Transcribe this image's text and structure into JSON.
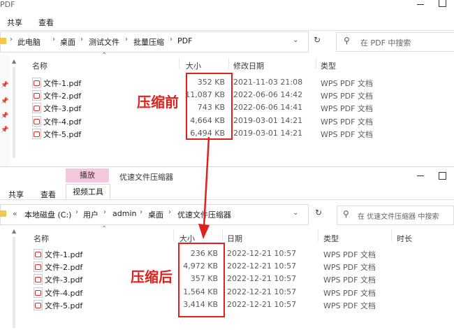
{
  "top_window": {
    "title": "PDF",
    "ribbon": {
      "tabs": [
        "共享",
        "查看"
      ]
    },
    "address": [
      "此电脑",
      "桌面",
      "测试文件",
      "批量压缩",
      "PDF"
    ],
    "search_placeholder": "在 PDF 中搜索",
    "columns": {
      "name": "名称",
      "size": "大小",
      "date": "修改日期",
      "type": "类型"
    },
    "rows": [
      {
        "name": "文件-1.pdf",
        "size": "352 KB",
        "date": "2021-11-03 21:08",
        "type": "WPS PDF 文档"
      },
      {
        "name": "文件-2.pdf",
        "size": "11,087 KB",
        "date": "2022-06-06 14:42",
        "type": "WPS PDF 文档"
      },
      {
        "name": "文件-3.pdf",
        "size": "743 KB",
        "date": "2022-06-06 14:41",
        "type": "WPS PDF 文档"
      },
      {
        "name": "文件-4.pdf",
        "size": "4,664 KB",
        "date": "2019-03-01 14:21",
        "type": "WPS PDF 文档"
      },
      {
        "name": "文件-5.pdf",
        "size": "6,494 KB",
        "date": "2019-03-01 14:21",
        "type": "WPS PDF 文档"
      }
    ],
    "annotation": "压缩前"
  },
  "bottom_window": {
    "title": "优速文件压缩器",
    "context_tab": "播放",
    "ribbon": {
      "tabs": [
        "共享",
        "查看"
      ],
      "context_tool": "视频工具"
    },
    "address_prefix": "«",
    "address": [
      "本地磁盘 (C:)",
      "用户",
      "admin",
      "桌面",
      "优速文件压缩器"
    ],
    "search_placeholder": "在 优速文件压缩器 中搜索",
    "columns": {
      "name": "名称",
      "size": "大小",
      "date": "日期",
      "type": "类型",
      "duration": "时长"
    },
    "rows": [
      {
        "name": "文件-1.pdf",
        "size": "236 KB",
        "date": "2022-12-21 10:57",
        "type": "WPS PDF 文档"
      },
      {
        "name": "文件-2.pdf",
        "size": "4,972 KB",
        "date": "2022-12-21 10:57",
        "type": "WPS PDF 文档"
      },
      {
        "name": "文件-3.pdf",
        "size": "357 KB",
        "date": "2022-12-21 10:57",
        "type": "WPS PDF 文档"
      },
      {
        "name": "文件-4.pdf",
        "size": "1,564 KB",
        "date": "2022-12-21 10:57",
        "type": "WPS PDF 文档"
      },
      {
        "name": "文件-5.pdf",
        "size": "3,414 KB",
        "date": "2022-12-21 10:57",
        "type": "WPS PDF 文档"
      }
    ],
    "annotation": "压缩后"
  },
  "icons": {
    "window_controls": [
      "minimize-icon",
      "maximize-icon"
    ],
    "refresh": "refresh-icon",
    "search": "search-icon",
    "sort": "sort-up-chevron-icon",
    "file": "pdf-file-icon",
    "folder": "folder-icon",
    "pin": "pin-icon",
    "arrow": "down-arrow-icon"
  },
  "colors": {
    "accent_red": "#e0201b",
    "context_tab_bg": "#f6c8dd",
    "context_tab_text": "#333333"
  }
}
